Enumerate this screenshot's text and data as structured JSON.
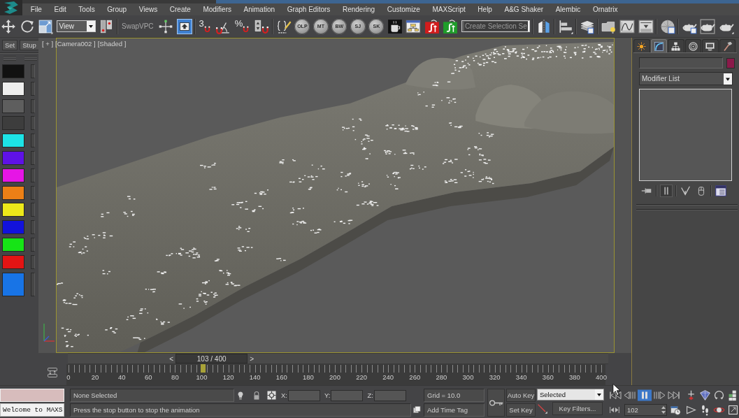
{
  "menu_bar": {
    "items": [
      "File",
      "Edit",
      "Tools",
      "Group",
      "Views",
      "Create",
      "Modifiers",
      "Animation",
      "Graph Editors",
      "Rendering",
      "Customize",
      "MAXScript",
      "Help",
      "A&G Shaker",
      "Alembic",
      "Ornatrix"
    ]
  },
  "toolbar": {
    "groups": [
      [
        {
          "kind": "tool",
          "selected": false
        },
        {
          "kind": "tool",
          "selected": false
        },
        {
          "kind": "tool",
          "selected": false
        },
        {
          "kind": "dropdown",
          "value": "View"
        },
        {
          "kind": "tool",
          "selected": false
        }
      ],
      [
        {
          "kind": "text_button",
          "label": "SwapVPC"
        },
        {
          "kind": "tool",
          "selected": false
        },
        {
          "kind": "tool",
          "selected": true
        }
      ],
      [
        {
          "kind": "snap",
          "label": "3",
          "selected": false
        },
        {
          "kind": "tool",
          "selected": false
        },
        {
          "kind": "snap",
          "label": "%",
          "selected": false
        },
        {
          "kind": "tool",
          "selected": false
        }
      ],
      [
        {
          "kind": "tool",
          "selected": false
        },
        {
          "kind": "badge",
          "label": "OLP"
        },
        {
          "kind": "badge",
          "label": "MT"
        },
        {
          "kind": "badge",
          "label": "BW"
        },
        {
          "kind": "badge",
          "label": "SJ"
        },
        {
          "kind": "badge",
          "label": "SK"
        },
        {
          "kind": "tool",
          "selected": false
        },
        {
          "kind": "tool",
          "selected": false
        },
        {
          "kind": "tool",
          "selected": false
        },
        {
          "kind": "tool",
          "selected": false
        },
        {
          "kind": "dropdown",
          "value": "Create Selection Se"
        }
      ],
      [
        {
          "kind": "tool",
          "selected": false
        }
      ],
      [
        {
          "kind": "tool",
          "selected": false
        }
      ],
      [
        {
          "kind": "tool",
          "selected": false
        }
      ],
      [
        {
          "kind": "tool",
          "selected": false
        },
        {
          "kind": "tool",
          "selected": false
        },
        {
          "kind": "tool",
          "selected": false
        }
      ],
      [
        {
          "kind": "tool",
          "selected": false
        }
      ],
      [
        {
          "kind": "tool",
          "selected": false
        },
        {
          "kind": "tool",
          "selected": false
        },
        {
          "kind": "tool",
          "selected": false
        }
      ]
    ]
  },
  "palette": {
    "buttons": [
      "Set",
      "Stup"
    ],
    "swatches": [
      {
        "color": "#111111"
      },
      {
        "color": "#eeeeee"
      },
      {
        "color": "#5e5e5e"
      },
      {
        "color": "#3d3d3d"
      },
      {
        "color": "#1de3e6"
      },
      {
        "color": "#5f12e6"
      },
      {
        "color": "#e615e6"
      },
      {
        "color": "#ec7f16"
      },
      {
        "color": "#ece81a"
      },
      {
        "color": "#1212dc"
      },
      {
        "color": "#16e416"
      },
      {
        "color": "#e41414"
      },
      {
        "color": "#1874e6"
      }
    ]
  },
  "viewport": {
    "labels": [
      "[ + ]",
      "[Camera002 ]",
      "[Shaded ]"
    ]
  },
  "command_panel": {
    "tabs": [
      {
        "selected": false
      },
      {
        "selected": true
      },
      {
        "selected": false
      },
      {
        "selected": false
      },
      {
        "selected": false
      },
      {
        "selected": false
      }
    ],
    "modifier_list": "Modifier List",
    "stack_buttons": [
      {
        "selected": false
      },
      {
        "selected": true
      },
      {
        "selected": false
      },
      {
        "selected": false
      },
      {
        "selected": false
      }
    ]
  },
  "time_slider": {
    "previous": "<",
    "label": "103 / 400",
    "next": ">"
  },
  "track_bar": {
    "labels": [
      "0",
      "20",
      "40",
      "60",
      "80",
      "100",
      "120",
      "140",
      "160",
      "180",
      "200",
      "220",
      "240",
      "260",
      "280",
      "300",
      "320",
      "340",
      "360",
      "380",
      "400"
    ],
    "level": 0.2525
  },
  "status_bar": {
    "listener_output": "Welcome to MAXS",
    "selection": "None Selected",
    "prompt": "Press the stop button to stop the animation",
    "coordinates": [
      "X:",
      "Y:",
      "Z:"
    ],
    "grid": "Grid = 10.0",
    "time_tag": "Add Time Tag",
    "auto_key": {
      "label": "Auto Key",
      "on": false
    },
    "key_set": "Selected",
    "set_key": "Set Key",
    "key_filters": "Key Filters...",
    "playback": [
      {
        "selected": false
      },
      {
        "selected": false
      },
      {
        "selected": true
      },
      {
        "selected": false
      },
      {
        "selected": false
      }
    ],
    "current_frame": "102"
  }
}
